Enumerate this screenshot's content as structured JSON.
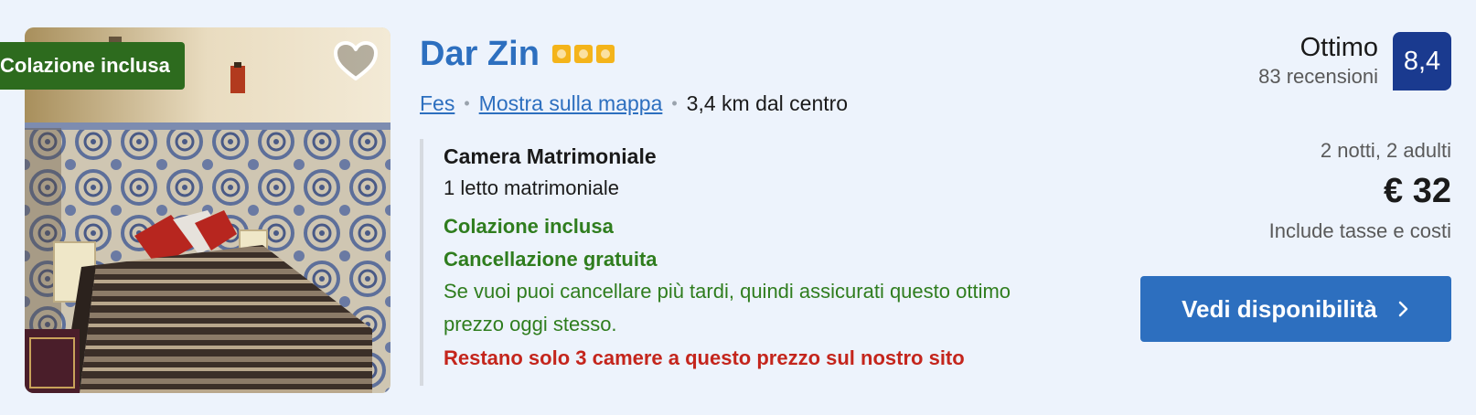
{
  "photo": {
    "badge": "Colazione inclusa",
    "favorite_icon": "heart-icon"
  },
  "hotel": {
    "name": "Dar Zin",
    "stars": 3,
    "star_color": "#f4b41a",
    "name_color": "#2d6fbf"
  },
  "location": {
    "city": "Fes",
    "map_link": "Mostra sulla mappa",
    "distance": "3,4 km dal centro"
  },
  "room": {
    "name": "Camera Matrimoniale",
    "bed": "1 letto matrimoniale",
    "breakfast": "Colazione inclusa",
    "cancellation": "Cancellazione gratuita",
    "cancellation_note": "Se vuoi puoi cancellare più tardi, quindi assicurati questo ottimo prezzo oggi stesso.",
    "scarcity": "Restano solo 3 camere a questo prezzo sul nostro sito"
  },
  "rating": {
    "word": "Ottimo",
    "reviews": "83 recensioni",
    "score": "8,4",
    "score_color": "#1a3a8f"
  },
  "pricing": {
    "stay": "2 notti, 2 adulti",
    "price": "€ 32",
    "taxes": "Include tasse e costi"
  },
  "cta": {
    "label": "Vedi disponibilità",
    "icon": "chevron-right-icon",
    "color": "#2d6fbf"
  }
}
